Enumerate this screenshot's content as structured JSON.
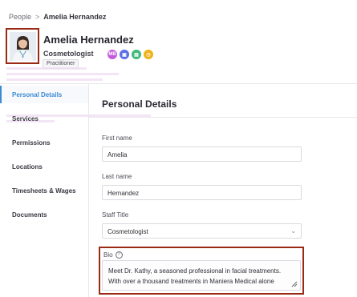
{
  "breadcrumb": {
    "parent": "People",
    "separator": ">",
    "current": "Amelia Hernandez"
  },
  "profile": {
    "name": "Amelia Hernandez",
    "title": "Cosmetologist",
    "role": "Practitioner",
    "badges": [
      {
        "icon": "mb-badge",
        "label": "MB",
        "color": "#c65bd8"
      },
      {
        "icon": "calendar-badge-icon",
        "label": "▣",
        "color": "#5b6ee6"
      },
      {
        "icon": "list-badge-icon",
        "label": "▤",
        "color": "#43b87c"
      },
      {
        "icon": "clock-badge-icon",
        "label": "◷",
        "color": "#f0b21a"
      }
    ]
  },
  "sidebar": {
    "items": [
      {
        "label": "Personal Details",
        "active": true
      },
      {
        "label": "Services",
        "active": false
      },
      {
        "label": "Permissions",
        "active": false
      },
      {
        "label": "Locations",
        "active": false
      },
      {
        "label": "Timesheets & Wages",
        "active": false
      },
      {
        "label": "Documents",
        "active": false
      }
    ]
  },
  "main": {
    "title": "Personal Details",
    "first_name": {
      "label": "First name",
      "value": "Amelia"
    },
    "last_name": {
      "label": "Last name",
      "value": "Hernandez"
    },
    "staff_title": {
      "label": "Staff Title",
      "value": "Cosmetologist"
    },
    "bio": {
      "label": "Bio",
      "value": "Meet Dr. Kathy, a seasoned professional in facial treatments. With over a thousand treatments in Maniera Medical alone"
    }
  },
  "colors": {
    "accent": "#3d8bd3",
    "highlight_frame": "#9a2a14"
  }
}
